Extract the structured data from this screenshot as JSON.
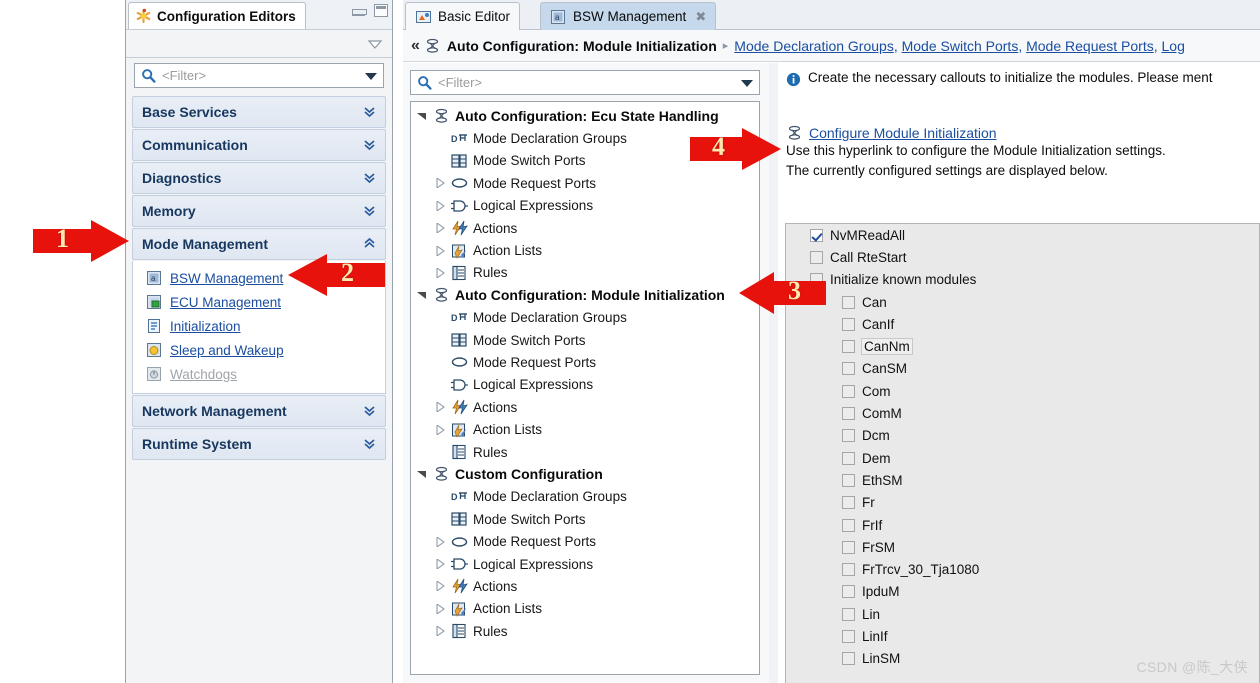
{
  "configuration_editors_view": {
    "tab_label": "Configuration Editors",
    "tab_icon": "asterisk-star-icon",
    "minimize_tooltip": "Minimize",
    "maximize_tooltip": "Maximize",
    "view_menu_icon": "view-menu-chevron-icon",
    "filter": {
      "placeholder": "<Filter>",
      "value": "",
      "icon": "search-icon",
      "dropdown_icon": "chevron-down-icon"
    },
    "categories": [
      {
        "label": "Base Services",
        "expanded": false,
        "chevron": "»"
      },
      {
        "label": "Communication",
        "expanded": false,
        "chevron": "»"
      },
      {
        "label": "Diagnostics",
        "expanded": false,
        "chevron": "»"
      },
      {
        "label": "Memory",
        "expanded": false,
        "chevron": "»"
      },
      {
        "label": "Mode Management",
        "expanded": true,
        "chevron": "«"
      },
      {
        "label": "Network Management",
        "expanded": false,
        "chevron": "»"
      },
      {
        "label": "Runtime System",
        "expanded": false,
        "chevron": "»"
      }
    ],
    "mode_management_items": [
      {
        "label": "BSW Management",
        "icon": "bsw-management-icon",
        "disabled": false
      },
      {
        "label": "ECU Management",
        "icon": "ecu-management-icon",
        "disabled": false
      },
      {
        "label": "Initialization",
        "icon": "initialization-icon",
        "disabled": false
      },
      {
        "label": "Sleep and Wakeup",
        "icon": "sleep-wakeup-icon",
        "disabled": false
      },
      {
        "label": "Watchdogs",
        "icon": "watchdogs-icon",
        "disabled": true
      }
    ]
  },
  "editor": {
    "tabs": [
      {
        "label": "Basic Editor",
        "icon": "basic-editor-icon",
        "active": false,
        "closable": false
      },
      {
        "label": "BSW Management",
        "icon": "bsw-management-icon",
        "active": true,
        "closable": true,
        "close_glyph": "✖"
      }
    ],
    "breadcrumb": {
      "back_glyph": "«",
      "icon": "auto-configuration-icon",
      "current": "Auto Configuration: Module Initialization",
      "separator": "▸",
      "links": [
        "Mode Declaration Groups",
        "Mode Switch Ports",
        "Mode Request Ports",
        "Log"
      ],
      "link_separator": ", "
    }
  },
  "tree_pane": {
    "filter": {
      "placeholder": "<Filter>",
      "value": "",
      "icon": "search-icon",
      "dropdown_icon": "chevron-down-icon"
    },
    "nodes": [
      {
        "label": "Auto Configuration: Ecu State Handling",
        "icon": "auto-configuration-icon",
        "expanded": true,
        "children": [
          {
            "label": "Mode Declaration Groups",
            "icon": "mode-declaration-groups-icon",
            "expandable": false
          },
          {
            "label": "Mode Switch Ports",
            "icon": "mode-switch-ports-icon",
            "expandable": false
          },
          {
            "label": "Mode Request Ports",
            "icon": "mode-request-ports-icon",
            "expandable": true
          },
          {
            "label": "Logical Expressions",
            "icon": "logical-expressions-icon",
            "expandable": true
          },
          {
            "label": "Actions",
            "icon": "actions-icon",
            "expandable": true
          },
          {
            "label": "Action Lists",
            "icon": "action-lists-icon",
            "expandable": true
          },
          {
            "label": "Rules",
            "icon": "rules-icon",
            "expandable": true
          }
        ]
      },
      {
        "label": "Auto Configuration: Module Initialization",
        "icon": "auto-configuration-icon",
        "expanded": true,
        "children": [
          {
            "label": "Mode Declaration Groups",
            "icon": "mode-declaration-groups-icon",
            "expandable": false
          },
          {
            "label": "Mode Switch Ports",
            "icon": "mode-switch-ports-icon",
            "expandable": false
          },
          {
            "label": "Mode Request Ports",
            "icon": "mode-request-ports-icon",
            "expandable": false
          },
          {
            "label": "Logical Expressions",
            "icon": "logical-expressions-icon",
            "expandable": false
          },
          {
            "label": "Actions",
            "icon": "actions-icon",
            "expandable": true
          },
          {
            "label": "Action Lists",
            "icon": "action-lists-icon",
            "expandable": true
          },
          {
            "label": "Rules",
            "icon": "rules-icon",
            "expandable": false
          }
        ]
      },
      {
        "label": "Custom Configuration",
        "icon": "auto-configuration-icon",
        "expanded": true,
        "children": [
          {
            "label": "Mode Declaration Groups",
            "icon": "mode-declaration-groups-icon",
            "expandable": false
          },
          {
            "label": "Mode Switch Ports",
            "icon": "mode-switch-ports-icon",
            "expandable": false
          },
          {
            "label": "Mode Request Ports",
            "icon": "mode-request-ports-icon",
            "expandable": true
          },
          {
            "label": "Logical Expressions",
            "icon": "logical-expressions-icon",
            "expandable": true
          },
          {
            "label": "Actions",
            "icon": "actions-icon",
            "expandable": true
          },
          {
            "label": "Action Lists",
            "icon": "action-lists-icon",
            "expandable": true
          },
          {
            "label": "Rules",
            "icon": "rules-icon",
            "expandable": true
          }
        ]
      }
    ]
  },
  "detail_pane": {
    "info_icon": "info-icon",
    "info_text": "Create the necessary callouts to initialize the modules. Please ment",
    "hyperlink_icon": "auto-configuration-icon",
    "hyperlink": "Configure Module Initialization",
    "description_line1": "Use this hyperlink to configure the Module Initialization settings.",
    "description_line2": "The currently configured settings are displayed below.",
    "options": [
      {
        "label": "NvMReadAll",
        "checked": true,
        "indent": false,
        "focused": false
      },
      {
        "label": "Call RteStart",
        "checked": false,
        "indent": false,
        "focused": false
      },
      {
        "label": "Initialize known modules",
        "checked": false,
        "indent": false,
        "focused": false
      },
      {
        "label": "Can",
        "checked": false,
        "indent": true,
        "focused": false
      },
      {
        "label": "CanIf",
        "checked": false,
        "indent": true,
        "focused": false
      },
      {
        "label": "CanNm",
        "checked": false,
        "indent": true,
        "focused": true
      },
      {
        "label": "CanSM",
        "checked": false,
        "indent": true,
        "focused": false
      },
      {
        "label": "Com",
        "checked": false,
        "indent": true,
        "focused": false
      },
      {
        "label": "ComM",
        "checked": false,
        "indent": true,
        "focused": false
      },
      {
        "label": "Dcm",
        "checked": false,
        "indent": true,
        "focused": false
      },
      {
        "label": "Dem",
        "checked": false,
        "indent": true,
        "focused": false
      },
      {
        "label": "EthSM",
        "checked": false,
        "indent": true,
        "focused": false
      },
      {
        "label": "Fr",
        "checked": false,
        "indent": true,
        "focused": false
      },
      {
        "label": "FrIf",
        "checked": false,
        "indent": true,
        "focused": false
      },
      {
        "label": "FrSM",
        "checked": false,
        "indent": true,
        "focused": false
      },
      {
        "label": "FrTrcv_30_Tja1080",
        "checked": false,
        "indent": true,
        "focused": false
      },
      {
        "label": "IpduM",
        "checked": false,
        "indent": true,
        "focused": false
      },
      {
        "label": "Lin",
        "checked": false,
        "indent": true,
        "focused": false
      },
      {
        "label": "LinIf",
        "checked": false,
        "indent": true,
        "focused": false
      },
      {
        "label": "LinSM",
        "checked": false,
        "indent": true,
        "focused": false
      }
    ]
  },
  "annotations": {
    "color": "#e8120c",
    "number_color": "#ffe9b0",
    "arrows": [
      {
        "label": "1",
        "direction": "right",
        "target": "mode-management-category"
      },
      {
        "label": "2",
        "direction": "left",
        "target": "bsw-management-link"
      },
      {
        "label": "3",
        "direction": "left",
        "target": "module-initialization-tree-node"
      },
      {
        "label": "4",
        "direction": "right",
        "target": "configure-module-initialization-link"
      }
    ]
  },
  "watermark": "CSDN @陈_大侠"
}
